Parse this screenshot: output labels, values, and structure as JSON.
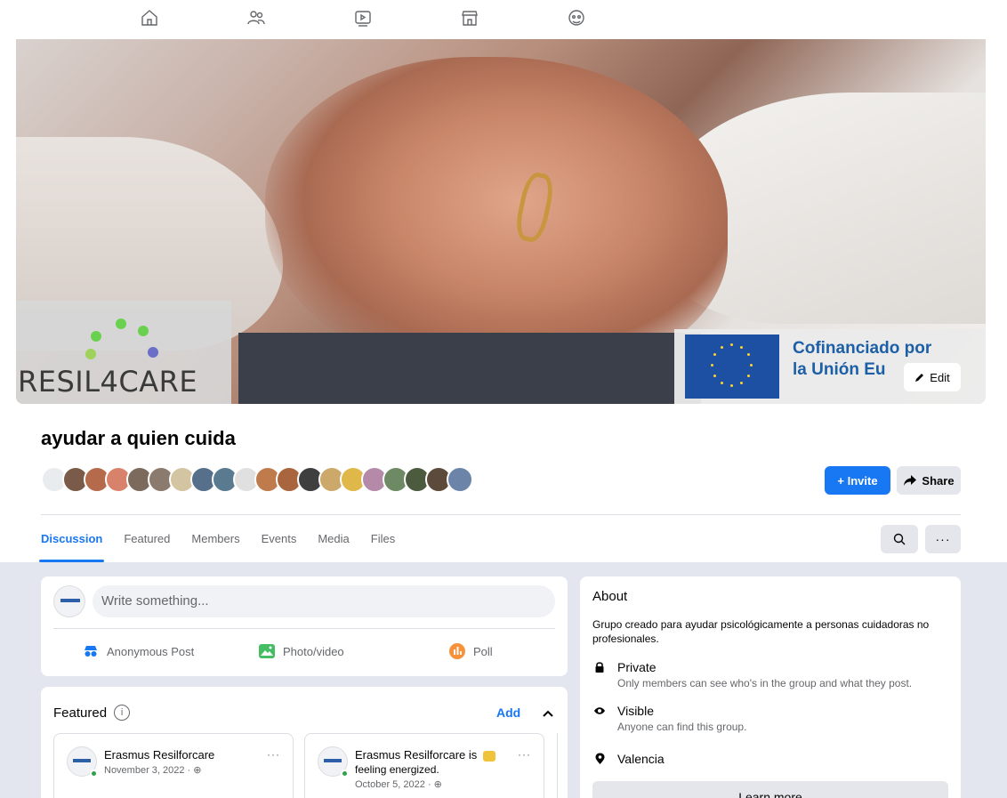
{
  "nav": {
    "icons": [
      "home-icon",
      "friends-icon",
      "watch-icon",
      "marketplace-icon",
      "groups-icon"
    ]
  },
  "cover": {
    "logo_text": "RESIL4CARE",
    "eu_line1": "Cofinanciado por",
    "eu_line2": "la Unión Eu",
    "edit_label": "Edit"
  },
  "group": {
    "name": "ayudar a quien cuida",
    "invite_label": "+ Invite",
    "share_label": "Share",
    "member_avatar_colors": [
      "#e9ecef",
      "#7a5b4a",
      "#b56b4b",
      "#d9826b",
      "#7c6a5d",
      "#8b7a6e",
      "#d3c5a1",
      "#566f8a",
      "#5a7a8f",
      "#e0e0e0",
      "#c07b4d",
      "#a8653e",
      "#3f3f3f",
      "#cca86b",
      "#e0b84a",
      "#b58aa8",
      "#6d8a64",
      "#4c5a3e",
      "#5c4b3a",
      "#6b84a8"
    ]
  },
  "tabs": [
    "Discussion",
    "Featured",
    "Members",
    "Events",
    "Media",
    "Files"
  ],
  "composer": {
    "placeholder": "Write something...",
    "actions": [
      {
        "label": "Anonymous Post",
        "icon": "anonymous-icon",
        "color": "#1877f2"
      },
      {
        "label": "Photo/video",
        "icon": "photo-icon",
        "color": "#45bd62"
      },
      {
        "label": "Poll",
        "icon": "poll-icon",
        "color": "#f7923b"
      }
    ]
  },
  "featured": {
    "title": "Featured",
    "add_label": "Add",
    "posts": [
      {
        "author": "Erasmus Resilforcare",
        "date": "November 3, 2022 · ",
        "feeling": ""
      },
      {
        "author": "Erasmus Resilforcare is",
        "date": "October 5, 2022 · ",
        "feeling": "feeling energized."
      }
    ]
  },
  "about": {
    "title": "About",
    "description": "Grupo creado para ayudar psicológicamente a personas cuidadoras no profesionales.",
    "privacy": {
      "label": "Private",
      "sub": "Only members can see who's in the group and what they post."
    },
    "visibility": {
      "label": "Visible",
      "sub": "Anyone can find this group."
    },
    "location": {
      "label": "Valencia"
    },
    "learn_more": "Learn more"
  }
}
